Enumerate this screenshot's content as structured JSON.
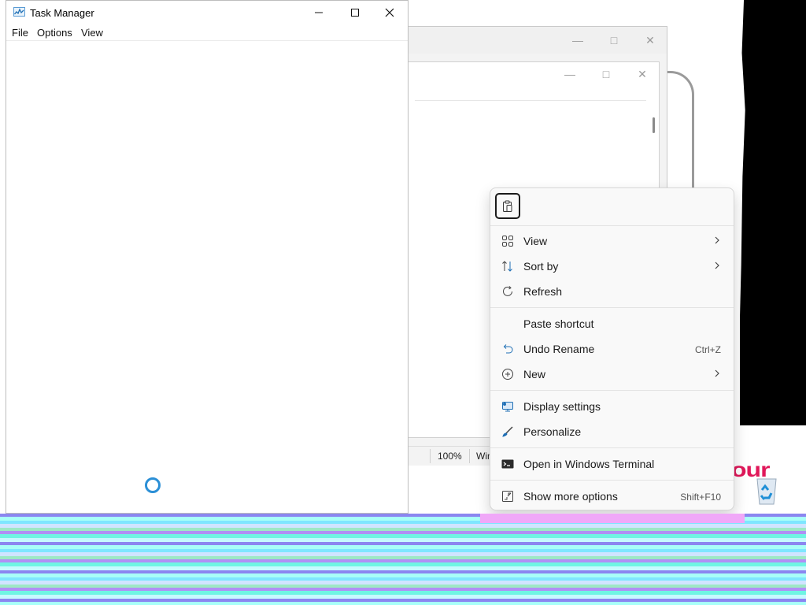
{
  "task_manager": {
    "title": "Task Manager",
    "menu": [
      "File",
      "Options",
      "View"
    ]
  },
  "status_bar": {
    "zoom": "100%",
    "encoding": "Win"
  },
  "context_menu": {
    "groups": [
      [
        {
          "label": "View",
          "icon": "grid-view-icon",
          "submenu": true
        },
        {
          "label": "Sort by",
          "icon": "sort-icon",
          "submenu": true
        },
        {
          "label": "Refresh",
          "icon": "refresh-icon",
          "submenu": false
        }
      ],
      [
        {
          "label": "Paste shortcut",
          "icon": "",
          "submenu": false
        },
        {
          "label": "Undo Rename",
          "icon": "undo-icon",
          "shortcut": "Ctrl+Z",
          "submenu": false
        },
        {
          "label": "New",
          "icon": "new-plus-icon",
          "submenu": true
        }
      ],
      [
        {
          "label": "Display settings",
          "icon": "display-settings-icon",
          "submenu": false
        },
        {
          "label": "Personalize",
          "icon": "personalize-brush-icon",
          "submenu": false
        }
      ],
      [
        {
          "label": "Open in Windows Terminal",
          "icon": "terminal-icon",
          "submenu": false
        }
      ],
      [
        {
          "label": "Show more options",
          "icon": "show-more-options-icon",
          "shortcut": "Shift+F10",
          "submenu": false
        }
      ]
    ],
    "accent": "#0067c0"
  },
  "desktop": {
    "icon_text": "our"
  }
}
